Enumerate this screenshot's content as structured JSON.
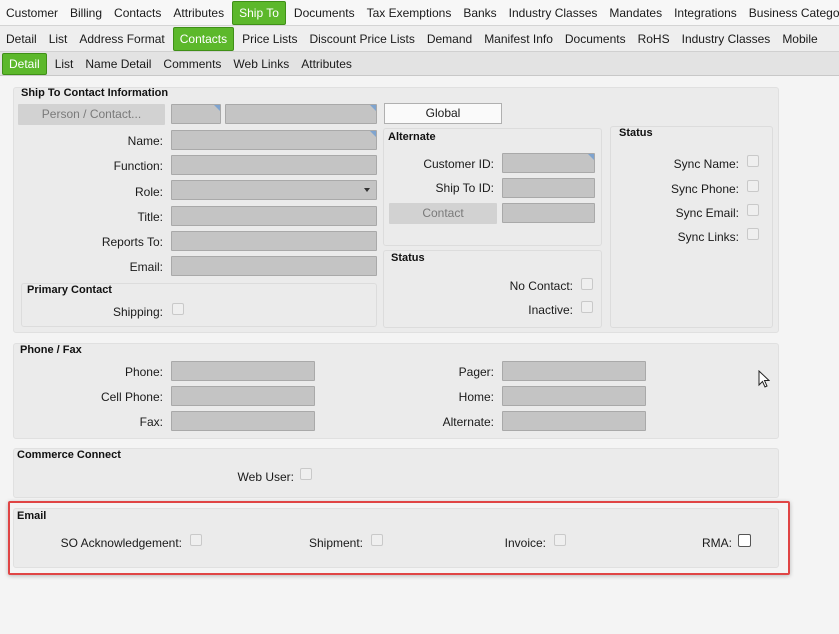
{
  "tabs_main": [
    "Customer",
    "Billing",
    "Contacts",
    "Attributes",
    "Ship To",
    "Documents",
    "Tax Exemptions",
    "Banks",
    "Industry Classes",
    "Mandates",
    "Integrations",
    "Business Category"
  ],
  "tabs_main_active": "Ship To",
  "tabs_sub": [
    "Detail",
    "List",
    "Address Format",
    "Contacts",
    "Price Lists",
    "Discount Price Lists",
    "Demand",
    "Manifest Info",
    "Documents",
    "RoHS",
    "Industry Classes",
    "Mobile"
  ],
  "tabs_sub_active": "Contacts",
  "tabs_detail": [
    "Detail",
    "List",
    "Name Detail",
    "Comments",
    "Web Links",
    "Attributes"
  ],
  "tabs_detail_active": "Detail",
  "ship_to_contact": {
    "title": "Ship To Contact Information",
    "person_button": "Person / Contact...",
    "global_button": "Global",
    "labels": {
      "name": "Name:",
      "function": "Function:",
      "role": "Role:",
      "title": "Title:",
      "reports_to": "Reports To:",
      "email": "Email:"
    },
    "primary_contact": {
      "title": "Primary Contact",
      "shipping": "Shipping:"
    },
    "alternate": {
      "title": "Alternate",
      "customer_id": "Customer ID:",
      "ship_to_id": "Ship To ID:",
      "contact_button": "Contact"
    },
    "status_mid": {
      "title": "Status",
      "no_contact": "No Contact:",
      "inactive": "Inactive:"
    },
    "status_right": {
      "title": "Status",
      "sync_name": "Sync Name:",
      "sync_phone": "Sync Phone:",
      "sync_email": "Sync Email:",
      "sync_links": "Sync Links:"
    }
  },
  "phone_fax": {
    "title": "Phone / Fax",
    "phone": "Phone:",
    "cell_phone": "Cell Phone:",
    "fax": "Fax:",
    "pager": "Pager:",
    "home": "Home:",
    "alternate": "Alternate:"
  },
  "commerce_connect": {
    "title": "Commerce Connect",
    "web_user": "Web User:"
  },
  "email_section": {
    "title": "Email",
    "so_ack": "SO Acknowledgement:",
    "shipment": "Shipment:",
    "invoice": "Invoice:",
    "rma": "RMA:"
  },
  "colors": {
    "active_tab": "#5cb82b",
    "highlight_border": "#e04545",
    "field": "#c4c4c4"
  }
}
